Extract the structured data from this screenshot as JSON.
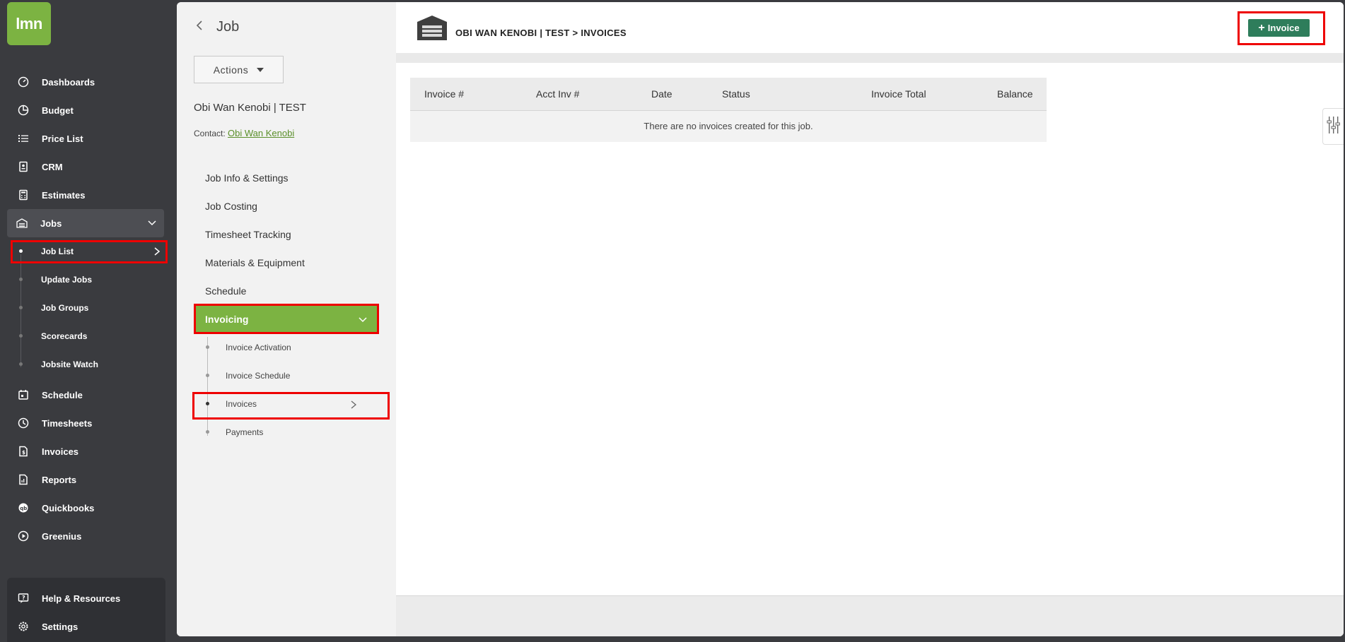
{
  "brand": {
    "logo_text": "lmn",
    "accent": "#7cb342"
  },
  "sidebar": {
    "items": [
      {
        "label": "Dashboards",
        "icon": "gauge-icon"
      },
      {
        "label": "Budget",
        "icon": "pie-chart-icon"
      },
      {
        "label": "Price List",
        "icon": "list-icon"
      },
      {
        "label": "CRM",
        "icon": "contact-card-icon"
      },
      {
        "label": "Estimates",
        "icon": "calculator-icon"
      },
      {
        "label": "Jobs",
        "icon": "garage-icon"
      },
      {
        "label": "Schedule",
        "icon": "calendar-icon"
      },
      {
        "label": "Timesheets",
        "icon": "clock-icon"
      },
      {
        "label": "Invoices",
        "icon": "invoice-icon"
      },
      {
        "label": "Reports",
        "icon": "report-icon"
      },
      {
        "label": "Quickbooks",
        "icon": "quickbooks-icon"
      },
      {
        "label": "Greenius",
        "icon": "play-circle-icon"
      }
    ],
    "jobs_sub": [
      "Job List",
      "Update Jobs",
      "Job Groups",
      "Scorecards",
      "Jobsite Watch"
    ],
    "bottom": [
      {
        "label": "Help & Resources",
        "icon": "help-icon"
      },
      {
        "label": "Settings",
        "icon": "gear-icon"
      }
    ]
  },
  "job_panel": {
    "title": "Job",
    "actions_label": "Actions",
    "job_name": "Obi Wan Kenobi | TEST",
    "contact_label": "Contact:",
    "contact_name": "Obi Wan Kenobi",
    "menu": [
      "Job Info & Settings",
      "Job Costing",
      "Timesheet Tracking",
      "Materials & Equipment",
      "Schedule"
    ],
    "invoicing_label": "Invoicing",
    "invoicing_sub": [
      "Invoice Activation",
      "Invoice Schedule",
      "Invoices",
      "Payments"
    ]
  },
  "content": {
    "breadcrumb": "OBI WAN KENOBI | TEST > INVOICES",
    "add_invoice_label": "Invoice",
    "add_invoice_color": "#2e7d5b",
    "table": {
      "headers": [
        "Invoice #",
        "Acct Inv #",
        "Date",
        "Status",
        "Invoice Total",
        "Balance"
      ],
      "empty_message": "There are no invoices created for this job."
    }
  },
  "annotation_color": "#ee0000"
}
